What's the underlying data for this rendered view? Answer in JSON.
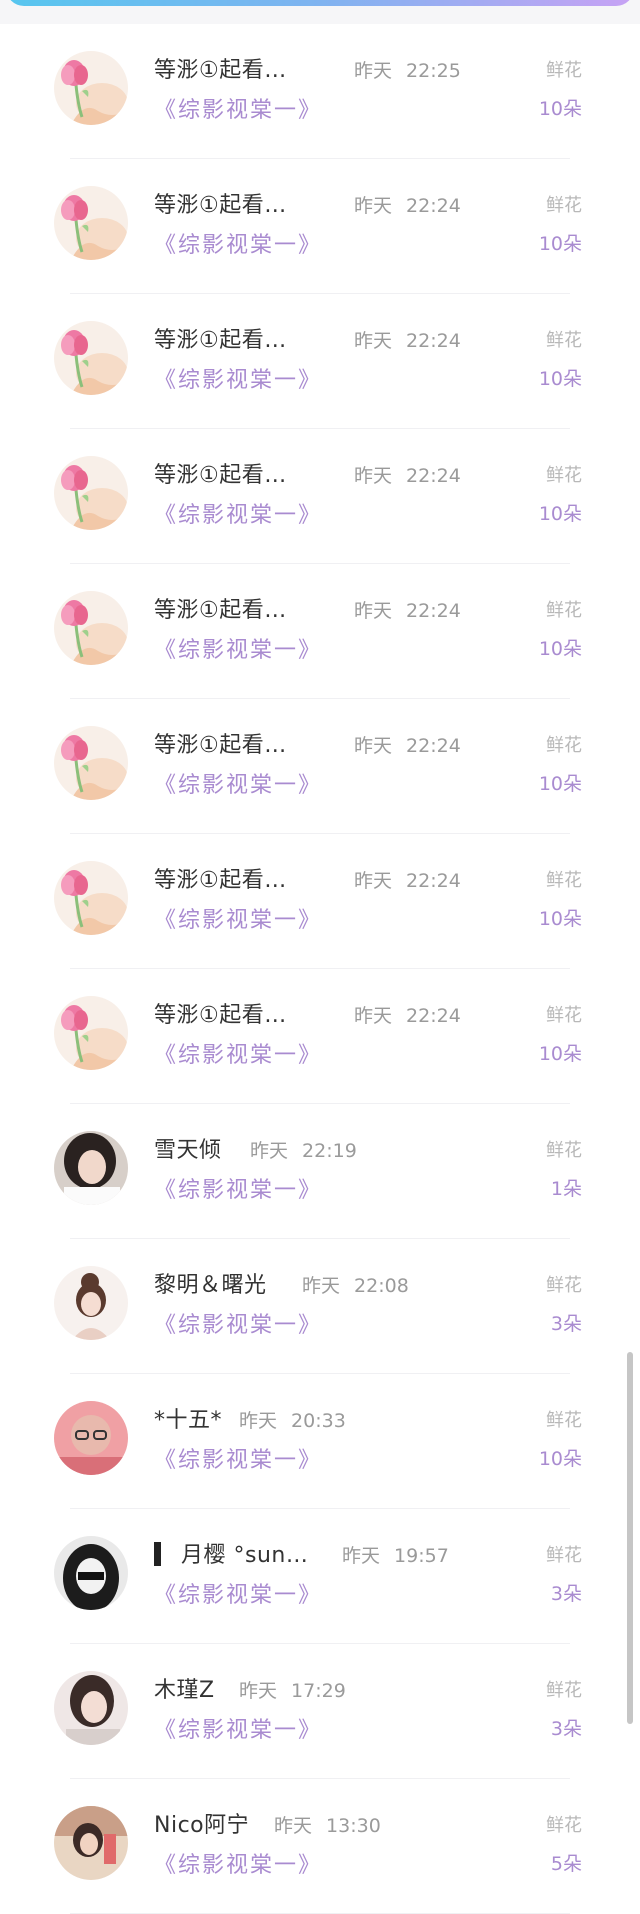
{
  "rows": [
    {
      "name": "等浵①起看…",
      "time": "昨天  22:25",
      "book": "《综影视棠一》",
      "gift_label": "鲜花",
      "gift_count": "10朵",
      "avatar": "tulip-avatar"
    },
    {
      "name": "等浵①起看…",
      "time": "昨天  22:24",
      "book": "《综影视棠一》",
      "gift_label": "鲜花",
      "gift_count": "10朵",
      "avatar": "tulip-avatar"
    },
    {
      "name": "等浵①起看…",
      "time": "昨天  22:24",
      "book": "《综影视棠一》",
      "gift_label": "鲜花",
      "gift_count": "10朵",
      "avatar": "tulip-avatar"
    },
    {
      "name": "等浵①起看…",
      "time": "昨天  22:24",
      "book": "《综影视棠一》",
      "gift_label": "鲜花",
      "gift_count": "10朵",
      "avatar": "tulip-avatar"
    },
    {
      "name": "等浵①起看…",
      "time": "昨天  22:24",
      "book": "《综影视棠一》",
      "gift_label": "鲜花",
      "gift_count": "10朵",
      "avatar": "tulip-avatar"
    },
    {
      "name": "等浵①起看…",
      "time": "昨天  22:24",
      "book": "《综影视棠一》",
      "gift_label": "鲜花",
      "gift_count": "10朵",
      "avatar": "tulip-avatar"
    },
    {
      "name": "等浵①起看…",
      "time": "昨天  22:24",
      "book": "《综影视棠一》",
      "gift_label": "鲜花",
      "gift_count": "10朵",
      "avatar": "tulip-avatar"
    },
    {
      "name": "等浵①起看…",
      "time": "昨天  22:24",
      "book": "《综影视棠一》",
      "gift_label": "鲜花",
      "gift_count": "10朵",
      "avatar": "tulip-avatar"
    },
    {
      "name": "雪天倾",
      "time": "昨天  22:19",
      "book": "《综影视棠一》",
      "gift_label": "鲜花",
      "gift_count": "1朵",
      "avatar": "woman-photo-avatar"
    },
    {
      "name": "黎明＆曙光",
      "time": "昨天  22:08",
      "book": "《综影视棠一》",
      "gift_label": "鲜花",
      "gift_count": "3朵",
      "avatar": "illustrated-girl-avatar"
    },
    {
      "name": "*十五*",
      "time": "昨天  20:33",
      "book": "《综影视棠一》",
      "gift_label": "鲜花",
      "gift_count": "10朵",
      "avatar": "pink-photo-avatar"
    },
    {
      "name": "月樱 °sun…",
      "time": "昨天  19:57",
      "book": "《综影视棠一》",
      "gift_label": "鲜花",
      "gift_count": "3朵",
      "avatar": "hooded-figure-avatar"
    },
    {
      "name": "木瑾Z",
      "time": "昨天  17:29",
      "book": "《综影视棠一》",
      "gift_label": "鲜花",
      "gift_count": "3朵",
      "avatar": "girl-photo-avatar"
    },
    {
      "name": "Nico阿宁",
      "time": "昨天  13:30",
      "book": "《综影视棠一》",
      "gift_label": "鲜花",
      "gift_count": "5朵",
      "avatar": "colorful-photo-avatar"
    }
  ],
  "colors": {
    "accent_purple": "#a98bd0",
    "muted_gray": "#9a9a9a",
    "header_gradient": [
      "#57c6ef",
      "#c7a2f4"
    ]
  }
}
